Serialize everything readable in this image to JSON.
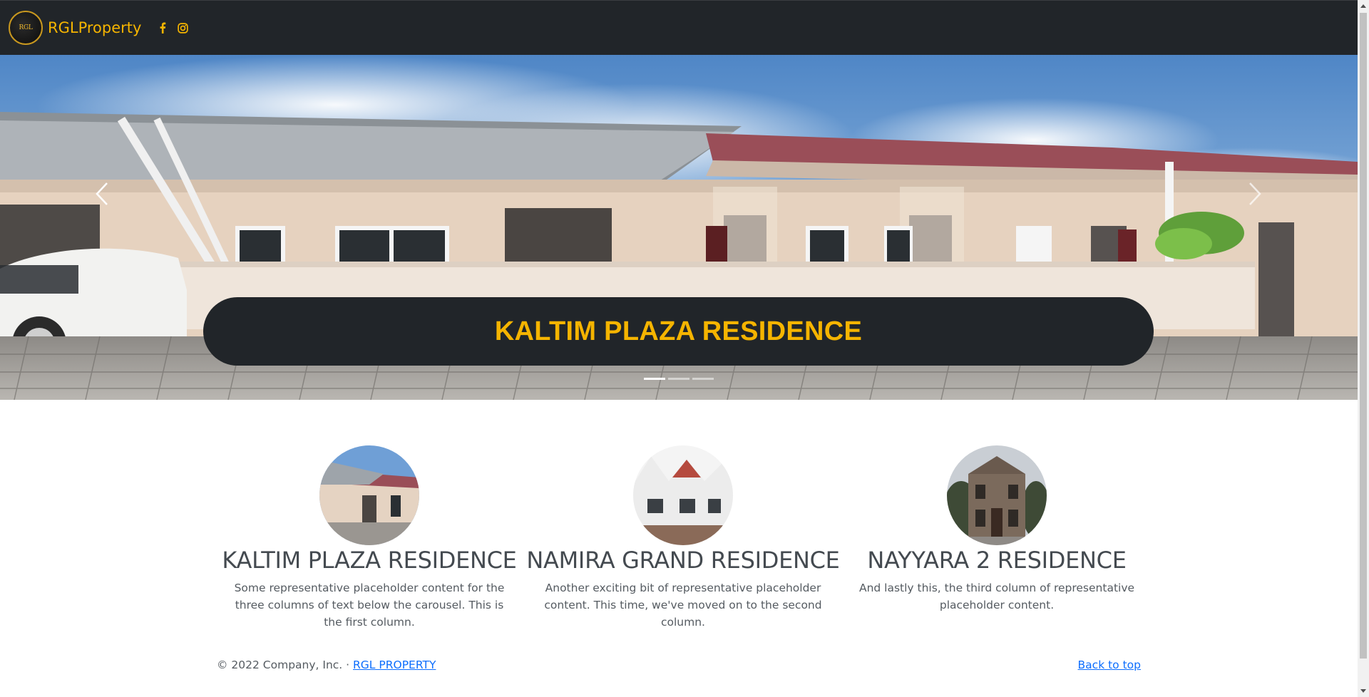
{
  "navbar": {
    "brand_name": "RGLProperty",
    "logo_text": "RGL",
    "social_icons": [
      "facebook-icon",
      "instagram-icon"
    ],
    "accent_color": "#f5b400",
    "background_color": "#212529"
  },
  "carousel": {
    "caption_title": "KALTIM PLAZA RESIDENCE",
    "prev_icon": "chevron-left-icon",
    "next_icon": "chevron-right-icon",
    "indicator_count": 3,
    "active_indicator": 1
  },
  "features": [
    {
      "title": "KALTIM PLAZA RESIDENCE",
      "text": "Some representative placeholder content for the three columns of text below the carousel. This is the first column."
    },
    {
      "title": "NAMIRA GRAND RESIDENCE",
      "text": "Another exciting bit of representative placeholder content. This time, we've moved on to the second column."
    },
    {
      "title": "NAYYARA 2 RESIDENCE",
      "text": "And lastly this, the third column of representative placeholder content."
    }
  ],
  "footer": {
    "copyright": "© 2022 Company, Inc. · ",
    "company_link": "RGL PROPERTY",
    "back_to_top": "Back to top",
    "link_color": "#0d6efd"
  }
}
